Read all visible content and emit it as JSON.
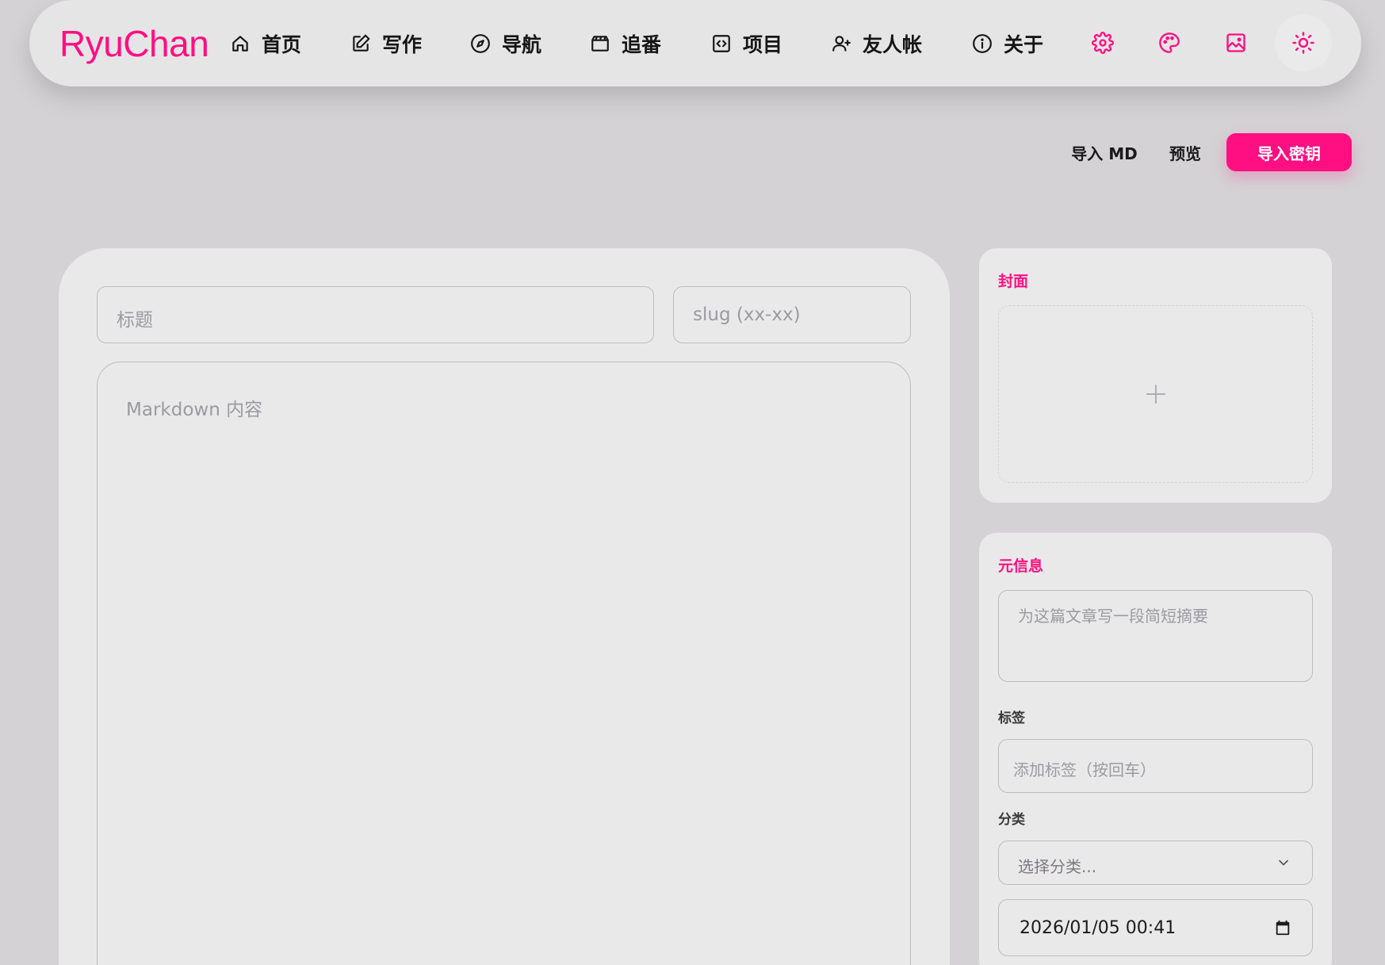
{
  "brand": {
    "name": "RyuChan",
    "accent": "#ff0f82"
  },
  "nav": {
    "items": [
      {
        "label": "首页",
        "icon": "home-icon"
      },
      {
        "label": "写作",
        "icon": "edit-icon"
      },
      {
        "label": "导航",
        "icon": "compass-icon"
      },
      {
        "label": "追番",
        "icon": "clapperboard-icon"
      },
      {
        "label": "项目",
        "icon": "code-icon"
      },
      {
        "label": "友人帐",
        "icon": "friends-icon"
      },
      {
        "label": "关于",
        "icon": "info-icon"
      }
    ],
    "actions": [
      "gear-icon",
      "palette-icon",
      "image-icon",
      "sun-icon"
    ]
  },
  "toolbar": {
    "import_md": "导入 MD",
    "preview": "预览",
    "import_key": "导入密钥"
  },
  "editor": {
    "title_placeholder": "标题",
    "slug_placeholder": "slug (xx-xx)",
    "content_placeholder": "Markdown 内容"
  },
  "cover": {
    "title": "封面"
  },
  "meta": {
    "title": "元信息",
    "summary_placeholder": "为这篇文章写一段简短摘要",
    "tags_label": "标签",
    "tags_placeholder": "添加标签（按回车）",
    "category_label": "分类",
    "category_value": "选择分类...",
    "date_value": "2026/01/05 00:41"
  }
}
